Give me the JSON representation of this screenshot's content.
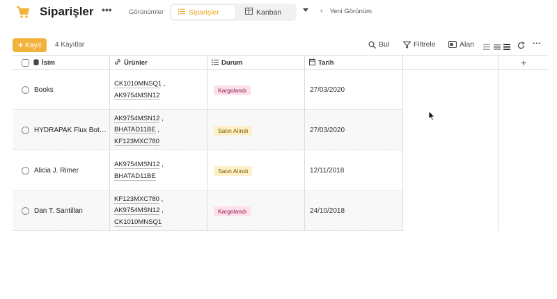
{
  "header": {
    "title": "Siparişler",
    "views_label": "Görünümler",
    "tabs": [
      {
        "label": "Siparişler",
        "icon": "list-icon",
        "active": true
      },
      {
        "label": "Kanban",
        "icon": "kanban-icon",
        "active": false
      }
    ],
    "new_view_label": "Yeni Görünüm",
    "new_view_plus": "+",
    "more": "•••"
  },
  "toolbar": {
    "add_label": "Kayıt",
    "add_plus": "+",
    "record_count": "4 Kayıtlar",
    "find_label": "Bul",
    "filter_label": "Filtrele",
    "field_label": "Alan",
    "more": "···"
  },
  "table": {
    "columns": [
      {
        "label": "İsim",
        "icon": "primary-field-icon"
      },
      {
        "label": "Ürünler",
        "icon": "link-icon"
      },
      {
        "label": "Durum",
        "icon": "list-icon"
      },
      {
        "label": "Tarih",
        "icon": "calendar-icon"
      }
    ],
    "add_column": "+",
    "rows": [
      {
        "name": "Books",
        "products": [
          "CK1010MNSQ1",
          "AK9754MSN12"
        ],
        "status": "Kargolandı",
        "status_color": "pink",
        "date": "27/03/2020"
      },
      {
        "name": "HYDRAPAK Flux Bott...",
        "products": [
          "AK9754MSN12",
          "BHATAD11BE",
          "KF123MXC780"
        ],
        "status": "Satın Alındı",
        "status_color": "yellow",
        "date": "27/03/2020"
      },
      {
        "name": "Alicia J. Rimer",
        "products": [
          "AK9754MSN12",
          "BHATAD11BE"
        ],
        "status": "Satın Alındı",
        "status_color": "yellow",
        "date": "12/11/2018"
      },
      {
        "name": "Dan T. Santillan",
        "products": [
          "KF123MXC780",
          "AK9754MSN12",
          "CK1010MNSQ1"
        ],
        "status": "Kargolandı",
        "status_color": "pink",
        "date": "24/10/2018"
      }
    ]
  },
  "colors": {
    "accent": "#f2b33d",
    "status_pink_bg": "#fde0ec",
    "status_yellow_bg": "#fdf0c8"
  }
}
